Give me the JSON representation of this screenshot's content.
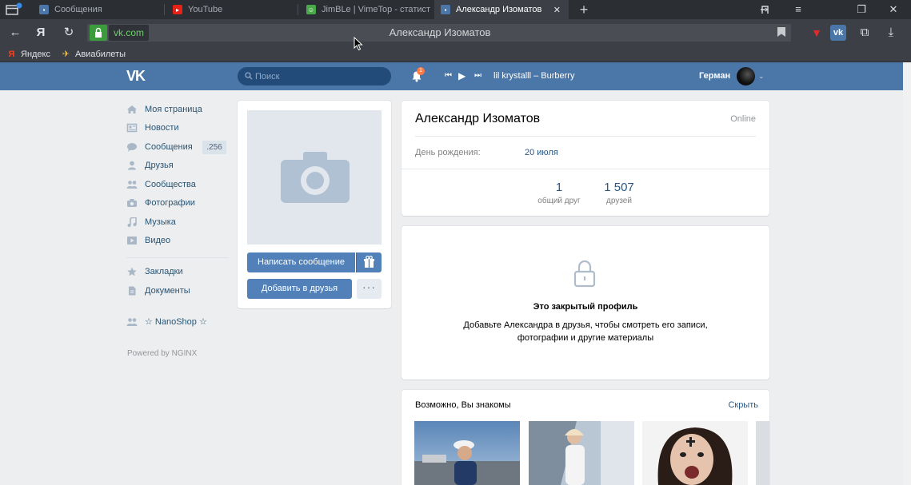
{
  "browser": {
    "tabs": [
      {
        "label": "Сообщения",
        "favicon_color": "#4a76a8",
        "active": false
      },
      {
        "label": "YouTube",
        "favicon_color": "#e62117",
        "active": false
      },
      {
        "label": "JimBLe | VimeTop - статист",
        "favicon_color": "#4aa84a",
        "active": false
      },
      {
        "label": "Александр Изоматов",
        "favicon_color": "#4a76a8",
        "active": true
      }
    ],
    "new_tab_icon": "plus-icon",
    "domain": "vk.com",
    "page_title": "Александр Изоматов",
    "bookmarks": [
      {
        "label": "Яндекс",
        "icon": "yandex-icon"
      },
      {
        "label": "Авиабилеты",
        "icon": "plane-icon"
      }
    ]
  },
  "vk": {
    "logo": "VK",
    "search_placeholder": "Поиск",
    "notifications_count": "1",
    "now_playing": "lil krystalll – Burberry",
    "username": "Герман",
    "menu": [
      {
        "label": "Моя страница",
        "icon": "home-icon"
      },
      {
        "label": "Новости",
        "icon": "news-icon"
      },
      {
        "label": "Сообщения",
        "icon": "messages-icon",
        "count": "256"
      },
      {
        "label": "Друзья",
        "icon": "friends-icon"
      },
      {
        "label": "Сообщества",
        "icon": "groups-icon"
      },
      {
        "label": "Фотографии",
        "icon": "camera-icon"
      },
      {
        "label": "Музыка",
        "icon": "music-icon"
      },
      {
        "label": "Видео",
        "icon": "video-icon"
      },
      {
        "label": "Закладки",
        "icon": "star-icon"
      },
      {
        "label": "Документы",
        "icon": "document-icon"
      },
      {
        "label": "☆ NanoShop ☆",
        "icon": "community-icon"
      }
    ],
    "powered_by": "Powered by NGINX"
  },
  "profile": {
    "name": "Александр Изоматов",
    "status": "Online",
    "birthday_label": "День рождения:",
    "birthday_value": "20 июля",
    "counters": [
      {
        "value": "1",
        "label": "общий друг"
      },
      {
        "value": "1 507",
        "label": "друзей"
      }
    ],
    "write_message": "Написать сообщение",
    "add_friend": "Добавить в друзья",
    "more_icon": "more-dots-icon",
    "gift_icon": "gift-icon",
    "closed_title": "Это закрытый профиль",
    "closed_desc": "Добавьте Александра в друзья, чтобы смотреть его записи, фотографии и другие материалы"
  },
  "suggestions": {
    "title": "Возможно, Вы знакомы",
    "hide": "Скрыть"
  }
}
